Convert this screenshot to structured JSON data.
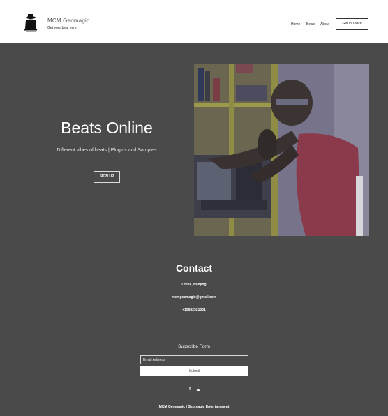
{
  "header": {
    "brand_name": "MCM Geomagic",
    "tagline": "Get your beat here",
    "nav": [
      "Home",
      "Beats",
      "About"
    ],
    "cta_label": "Get in Touch",
    "logo_icon": "hat-man-logo-icon"
  },
  "hero": {
    "title": "Beats Online",
    "subtitle": "Different vibes of beats | Plugins and Samples",
    "signup_label": "SIGN UP"
  },
  "contact": {
    "title": "Contact",
    "address": "China, Nanjing",
    "email": "mcmgeomagic@gmail.com",
    "phone": "+15852921031"
  },
  "subscribe": {
    "title": "Subscribe Form",
    "placeholder": "Email Address",
    "button_label": "Submit"
  },
  "social": {
    "facebook_glyph": "f",
    "soundcloud_glyph": "☁",
    "icons": [
      "facebook-icon",
      "soundcloud-icon"
    ]
  },
  "footer": {
    "text": "MCM Geomagic | Geomagic Entertainment"
  },
  "colors": {
    "background": "#4a4a4a",
    "header_bg": "#ffffff",
    "text_light": "#ffffff"
  }
}
